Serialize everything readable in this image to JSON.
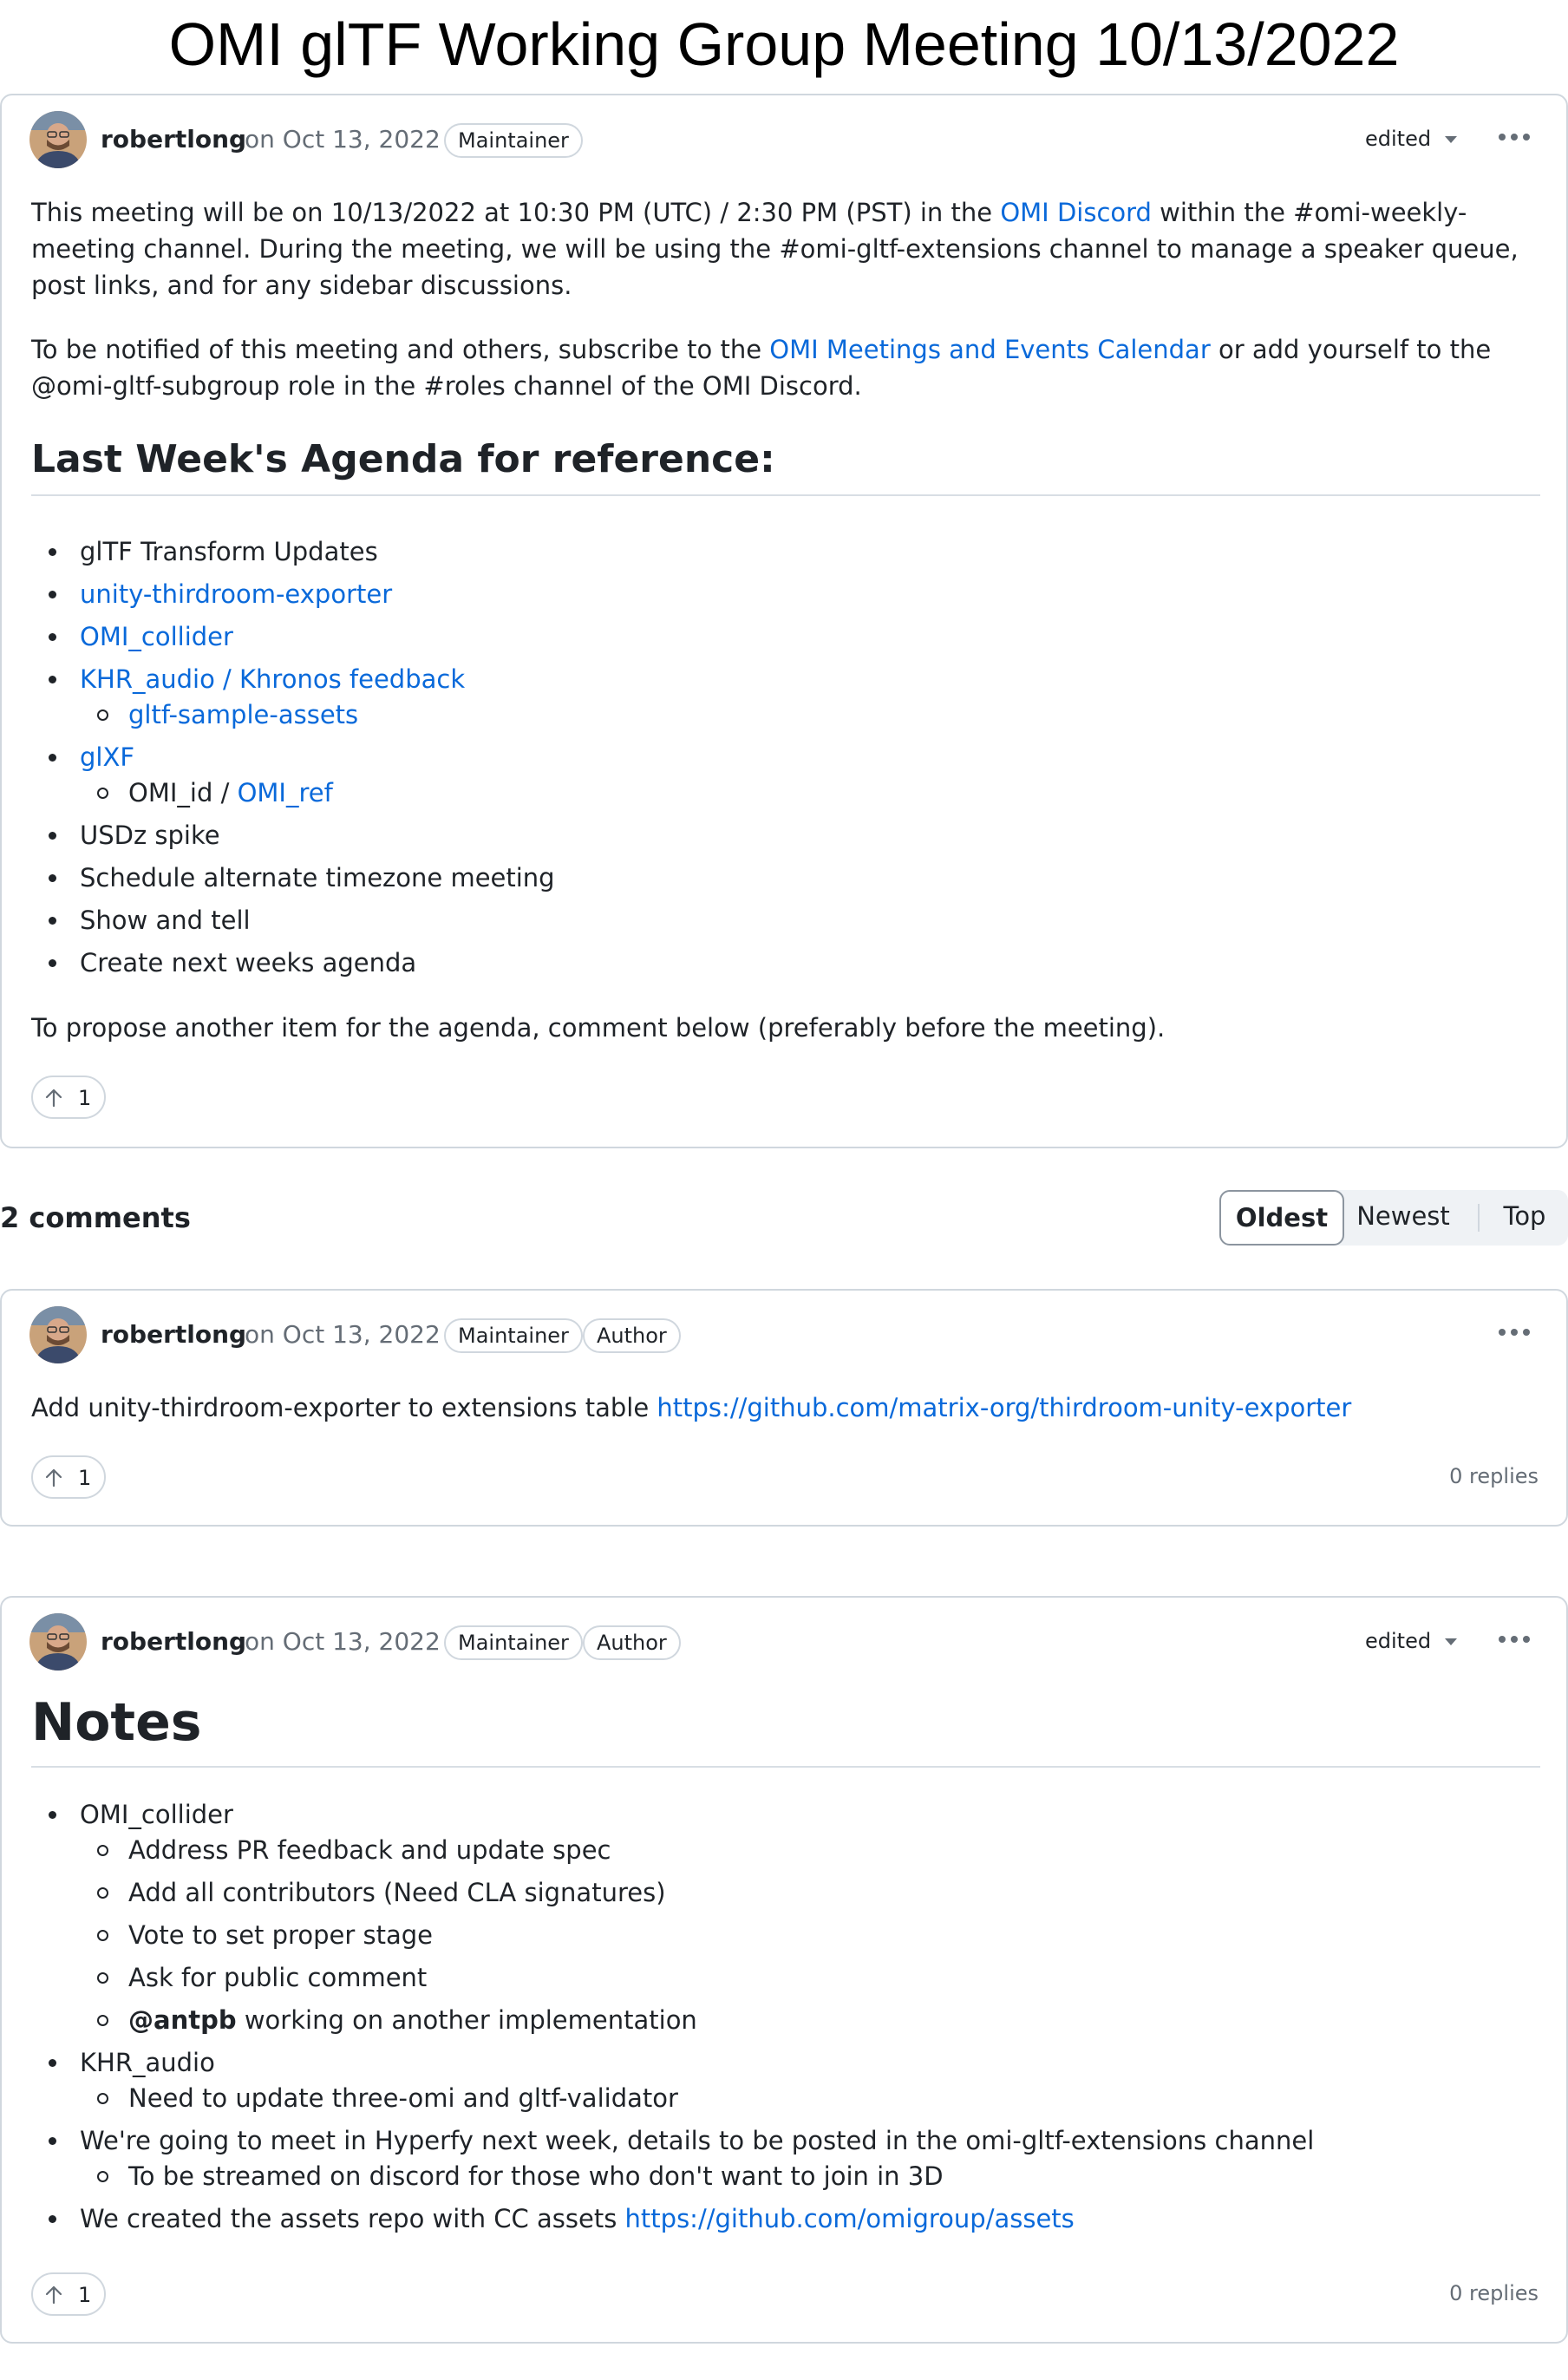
{
  "page_title": "OMI glTF Working Group Meeting 10/13/2022",
  "post": {
    "author": "robertlong",
    "date": "on Oct 13, 2022",
    "badge": "Maintainer",
    "edited": "edited",
    "p1_a": "This meeting will be on 10/13/2022 at 10:30 PM (UTC) / 2:30 PM (PST) in the ",
    "p1_link": "OMI Discord",
    "p1_b": " within the #omi-weekly-meeting channel. During the meeting, we will be using the #omi-gltf-extensions channel to manage a speaker queue, post links, and for any sidebar discussions.",
    "p2_a": "To be notified of this meeting and others, subscribe to the ",
    "p2_link": "OMI Meetings and Events Calendar",
    "p2_b": " or add yourself to the @omi-gltf-subgroup role in the #roles channel of the OMI Discord.",
    "heading": "Last Week's Agenda for reference:",
    "agenda": {
      "i1": "glTF Transform Updates",
      "i2": "unity-thirdroom-exporter",
      "i3": "OMI_collider",
      "i4": "KHR_audio / Khronos feedback",
      "i4_sub": "gltf-sample-assets",
      "i5": "glXF",
      "i5_sub_a": "OMI_id / ",
      "i5_sub_link": "OMI_ref",
      "i6": "USDz spike",
      "i7": "Schedule alternate timezone meeting",
      "i8": "Show and tell",
      "i9": "Create next weeks agenda"
    },
    "closing": "To propose another item for the agenda, comment below (preferably before the meeting).",
    "upvotes": "1"
  },
  "comments_header": {
    "count": "2 comments",
    "sort": {
      "oldest": "Oldest",
      "newest": "Newest",
      "top": "Top"
    }
  },
  "comment1": {
    "author": "robertlong",
    "date": "on Oct 13, 2022",
    "badge1": "Maintainer",
    "badge2": "Author",
    "text": "Add unity-thirdroom-exporter to extensions table ",
    "link": "https://github.com/matrix-org/thirdroom-unity-exporter",
    "upvotes": "1",
    "replies": "0 replies"
  },
  "comment2": {
    "author": "robertlong",
    "date": "on Oct 13, 2022",
    "badge1": "Maintainer",
    "badge2": "Author",
    "edited": "edited",
    "heading": "Notes",
    "n1": "OMI_collider",
    "n1_s1": "Address PR feedback and update spec",
    "n1_s2": "Add all contributors (Need CLA signatures)",
    "n1_s3": "Vote to set proper stage",
    "n1_s4": "Ask for public comment",
    "n1_s5_mention": "@antpb",
    "n1_s5_text": " working on another implementation",
    "n2": "KHR_audio",
    "n2_s1": "Need to update three-omi and gltf-validator",
    "n3": "We're going to meet in Hyperfy next week, details to be posted in the omi-gltf-extensions channel",
    "n3_s1": "To be streamed on discord for those who don't want to join in 3D",
    "n4_text": "We created the assets repo with CC assets ",
    "n4_link": "https://github.com/omigroup/assets",
    "upvotes": "1",
    "replies": "0 replies"
  }
}
